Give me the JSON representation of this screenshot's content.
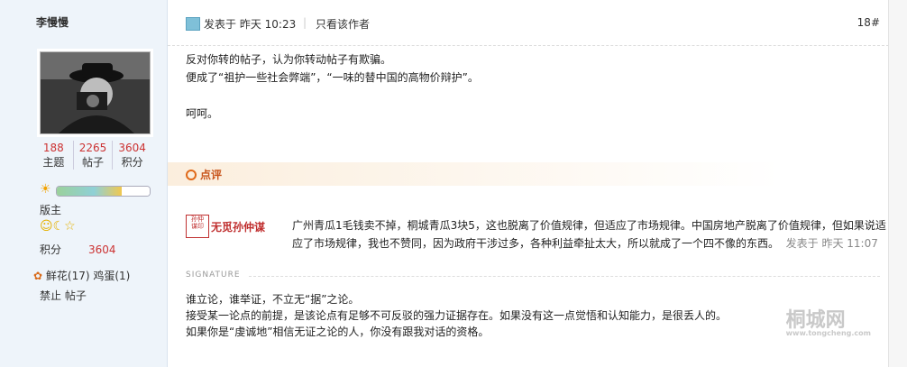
{
  "user": {
    "name": "李慢慢",
    "stats": [
      {
        "value": "188",
        "label": "主题"
      },
      {
        "value": "2265",
        "label": "帖子"
      },
      {
        "value": "3604",
        "label": "积分"
      }
    ],
    "rank_progress": 0.7,
    "title": "版主",
    "credit_label": "积分",
    "credit_value": "3604",
    "gifts": "鲜花(17) 鸡蛋(1)",
    "actions": "禁止 帖子"
  },
  "post": {
    "posted_prefix": "发表于 昨天 10:23",
    "only_author": "只看该作者",
    "floor": "18#",
    "lines": [
      "反对你转的帖子，认为你转动帖子有欺骗。",
      "便成了“祖护一些社会弊端”，“一味的替中国的高物价辩护”。",
      "",
      "呵呵。"
    ]
  },
  "comment": {
    "header": "点评",
    "stamp": "孙仲谋印",
    "user": "无觅孙仲谋",
    "text": "广州青瓜1毛钱卖不掉，桐城青瓜3块5，这也脱离了价值规律，但适应了市场规律。中国房地产脱离了价值规律，但如果说适应了市场规律，我也不赞同，因为政府干涉过多，各种利益牵扯太大，所以就成了一个四不像的东西。",
    "time": "发表于 昨天 11:07"
  },
  "signature": {
    "label": "SIGNATURE",
    "lines": [
      "谁立论，谁举证，不立无“据”之论。",
      "接受某一论点的前提，是该论点有足够不可反驳的强力证据存在。如果没有这一点觉悟和认知能力，是很丢人的。",
      "如果你是“虔诚地”相信无证之论的人，你没有跟我对话的资格。"
    ]
  },
  "watermark": {
    "text": "桐城网",
    "url": "www.tongcheng.com"
  }
}
